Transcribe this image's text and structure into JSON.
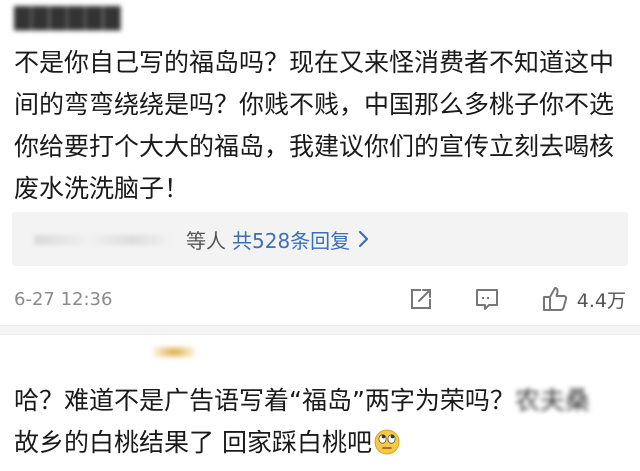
{
  "comment1": {
    "username": "██████",
    "text": "不是你自己写的福岛吗？现在又来怪消费者不知道这中间的弯弯绕绕是吗？你贱不贱，中国那么多桃子你不选你给要打个大大的福岛，我建议你们的宣传立刻去喝核废水洗洗脑子！",
    "replies": {
      "suffix": "等人",
      "count_label": "共528条回复"
    },
    "timestamp": "6-27 12:36",
    "like_count": "4.4万"
  },
  "comment2": {
    "text_part1": "哈？难道不是广告语写着“福岛”两字为荣吗？",
    "text_blurred": "农夫桑",
    "text_part2": "故乡的白桃结果了 回家踩白桃吧",
    "emoji": "rolling-eyes-emoji"
  },
  "colors": {
    "link": "#3b6fb6",
    "meta": "#8a8a8a",
    "reply_bg": "#f3f3f3"
  }
}
